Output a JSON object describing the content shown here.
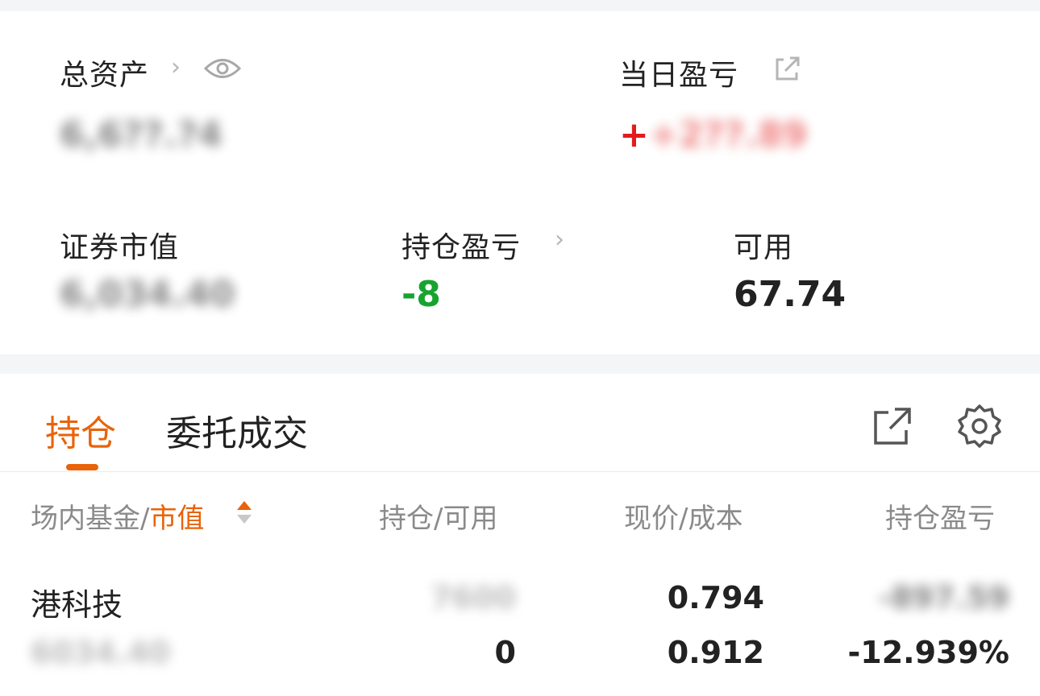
{
  "summary": {
    "total_assets": {
      "label": "总资产",
      "value": "6,6??.?4"
    },
    "day_pnl": {
      "label": "当日盈亏",
      "value": "+2??.89"
    },
    "securities_value": {
      "label": "证券市值",
      "value": "6,034.40"
    },
    "position_pnl": {
      "label": "持仓盈亏",
      "value": "-8"
    },
    "available": {
      "label": "可用",
      "value": "67.74"
    },
    "icons": {
      "chevron": "chevron-right-icon",
      "eye": "eye-icon",
      "share": "share-icon",
      "settings": "gear-icon"
    }
  },
  "tabs": [
    {
      "label": "持仓",
      "active": true
    },
    {
      "label": "委托成交",
      "active": false
    }
  ],
  "table": {
    "headers": {
      "name": "场内基金",
      "sep1": "/",
      "sort_field": "市值",
      "position": "持仓",
      "sep2": "/",
      "available": "可用",
      "price": "现价",
      "sep3": "/",
      "cost": "成本",
      "pnl": "持仓盈亏"
    },
    "rows": [
      {
        "name": "港科技",
        "market_value": "6034.40",
        "position": "7600",
        "available": "0",
        "price": "0.794",
        "cost": "0.912",
        "pnl": "-897.59",
        "pnl_pct": "-12.939%"
      }
    ]
  },
  "colors": {
    "accent": "#e8630a",
    "up": "#e21c1c",
    "down": "#16a32f",
    "muted": "#8a8a8a"
  }
}
